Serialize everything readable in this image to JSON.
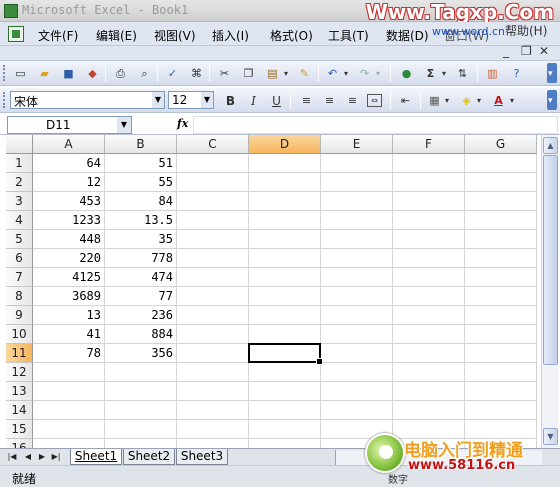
{
  "window": {
    "title": "Microsoft Excel - Book1",
    "watermark_top": "Www.Tagxp.Com",
    "watermark_menu": "www.word.cn"
  },
  "menubar": {
    "items": [
      {
        "label": "文件(F)"
      },
      {
        "label": "编辑(E)"
      },
      {
        "label": "视图(V)"
      },
      {
        "label": "插入(I)"
      },
      {
        "label": "格式(O)"
      },
      {
        "label": "工具(T)"
      },
      {
        "label": "数据(D)"
      },
      {
        "label": "窗口(W)"
      },
      {
        "label": "帮助(H)"
      }
    ],
    "window_controls": [
      "_",
      "❐",
      "✕"
    ]
  },
  "formatting": {
    "font_name": "宋体",
    "font_size": "12",
    "bold": "B",
    "italic": "I",
    "underline": "U"
  },
  "formula_bar": {
    "name_box": "D11",
    "fx_label": "fx",
    "content": ""
  },
  "sheet": {
    "columns": [
      "A",
      "B",
      "C",
      "D",
      "E",
      "F",
      "G"
    ],
    "active_column": "D",
    "rows": [
      "1",
      "2",
      "3",
      "4",
      "5",
      "6",
      "7",
      "8",
      "9",
      "10",
      "11",
      "12",
      "13",
      "14",
      "15",
      "16"
    ],
    "active_row": "11",
    "active_cell": "D11",
    "values": [
      [
        "64",
        "51"
      ],
      [
        "12",
        "55"
      ],
      [
        "453",
        "84"
      ],
      [
        "1233",
        "13.5"
      ],
      [
        "448",
        "35"
      ],
      [
        "220",
        "778"
      ],
      [
        "4125",
        "474"
      ],
      [
        "3689",
        "77"
      ],
      [
        "13",
        "236"
      ],
      [
        "41",
        "884"
      ],
      [
        "78",
        "356"
      ]
    ]
  },
  "tabs": {
    "sheets": [
      "Sheet1",
      "Sheet2",
      "Sheet3"
    ],
    "active": "Sheet1"
  },
  "statusbar": {
    "ready": "就绪",
    "num": "数字"
  },
  "logo": {
    "cn_text": "电脑入门到精通",
    "url": "www.58116.cn"
  },
  "colors": {
    "active_header": "#f5b65e",
    "toolbar_bg": "#dfe6f2",
    "accent": "#4e7dc6"
  }
}
